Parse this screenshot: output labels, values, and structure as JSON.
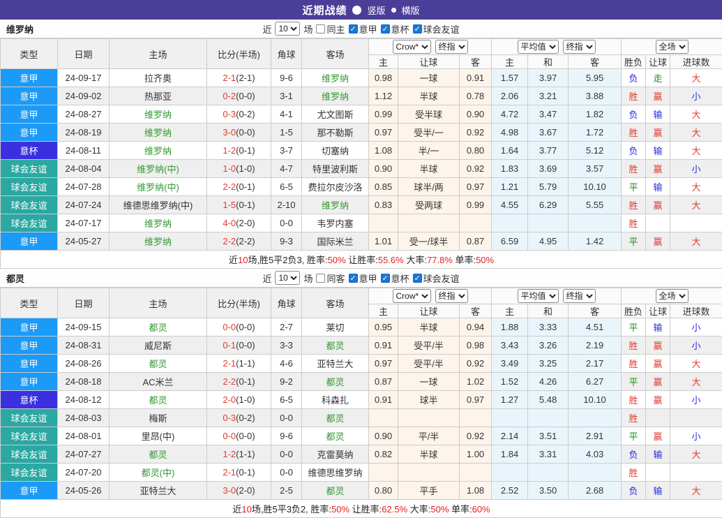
{
  "title_bar": {
    "title": "近期战绩",
    "radio_vertical": "竖版",
    "radio_horizontal": "横版"
  },
  "colors": {
    "titlebar_purple": "#4b3e98",
    "league_serie_a_blue": "#1b9af7",
    "league_cup_indigo": "#3a30e0",
    "league_friendly_teal": "#2aa8a1",
    "win_red": "#e23b2e",
    "lose_blue": "#2929e0",
    "draw_green": "#1e8c1e",
    "team_highlight_green": "#339933"
  },
  "table_header": {
    "cols": [
      "类型",
      "日期",
      "主场",
      "比分(半场)",
      "角球",
      "客场"
    ],
    "book_select": "Crow*",
    "final_select": "终指",
    "avg_select": "平均值",
    "final_select2": "终指",
    "fullmatch_select": "全场",
    "sub_cols": [
      "主",
      "让球",
      "客",
      "主",
      "和",
      "客",
      "胜负",
      "让球",
      "进球数"
    ]
  },
  "sections": [
    {
      "team": "维罗纳",
      "filter": {
        "near_label": "近",
        "games_value": "10",
        "games_label": "场",
        "same_label": "同主",
        "leagues": [
          "意甲",
          "意杯",
          "球会友谊"
        ]
      },
      "rows": [
        {
          "league": "意甲",
          "lk": "a",
          "date": "24-09-17",
          "home": "拉齐奥",
          "hh": false,
          "score": "2-1",
          "half": "(2-1)",
          "corner": "9-6",
          "away": "维罗纳",
          "ah": true,
          "o1": "0.98",
          "hc": "一球",
          "o2": "0.91",
          "m1": "1.57",
          "m2": "3.97",
          "m3": "5.95",
          "r1": "负",
          "r2": "走",
          "r3": "大"
        },
        {
          "league": "意甲",
          "lk": "a",
          "date": "24-09-02",
          "home": "热那亚",
          "hh": false,
          "score": "0-2",
          "half": "(0-0)",
          "corner": "3-1",
          "away": "维罗纳",
          "ah": true,
          "o1": "1.12",
          "hc": "半球",
          "o2": "0.78",
          "m1": "2.06",
          "m2": "3.21",
          "m3": "3.88",
          "r1": "胜",
          "r2": "赢",
          "r3": "小"
        },
        {
          "league": "意甲",
          "lk": "a",
          "date": "24-08-27",
          "home": "维罗纳",
          "hh": true,
          "score": "0-3",
          "half": "(0-2)",
          "corner": "4-1",
          "away": "尤文图斯",
          "ah": false,
          "o1": "0.99",
          "hc": "受半球",
          "o2": "0.90",
          "m1": "4.72",
          "m2": "3.47",
          "m3": "1.82",
          "r1": "负",
          "r2": "输",
          "r3": "大"
        },
        {
          "league": "意甲",
          "lk": "a",
          "date": "24-08-19",
          "home": "维罗纳",
          "hh": true,
          "score": "3-0",
          "half": "(0-0)",
          "corner": "1-5",
          "away": "那不勒斯",
          "ah": false,
          "o1": "0.97",
          "hc": "受半/一",
          "o2": "0.92",
          "m1": "4.98",
          "m2": "3.67",
          "m3": "1.72",
          "r1": "胜",
          "r2": "赢",
          "r3": "大"
        },
        {
          "league": "意杯",
          "lk": "c",
          "date": "24-08-11",
          "home": "维罗纳",
          "hh": true,
          "score": "1-2",
          "half": "(0-1)",
          "corner": "3-7",
          "away": "切塞纳",
          "ah": false,
          "o1": "1.08",
          "hc": "半/一",
          "o2": "0.80",
          "m1": "1.64",
          "m2": "3.77",
          "m3": "5.12",
          "r1": "负",
          "r2": "输",
          "r3": "大"
        },
        {
          "league": "球会友谊",
          "lk": "f",
          "date": "24-08-04",
          "home": "维罗纳(中)",
          "hh": true,
          "score": "1-0",
          "half": "(1-0)",
          "corner": "4-7",
          "away": "特里波利斯",
          "ah": false,
          "o1": "0.90",
          "hc": "半球",
          "o2": "0.92",
          "m1": "1.83",
          "m2": "3.69",
          "m3": "3.57",
          "r1": "胜",
          "r2": "赢",
          "r3": "小"
        },
        {
          "league": "球会友谊",
          "lk": "f",
          "date": "24-07-28",
          "home": "维罗纳(中)",
          "hh": true,
          "score": "2-2",
          "half": "(0-1)",
          "corner": "6-5",
          "away": "费拉尔皮沙洛",
          "ah": false,
          "o1": "0.85",
          "hc": "球半/两",
          "o2": "0.97",
          "m1": "1.21",
          "m2": "5.79",
          "m3": "10.10",
          "r1": "平",
          "r2": "输",
          "r3": "大"
        },
        {
          "league": "球会友谊",
          "lk": "f",
          "date": "24-07-24",
          "home": "维德思维罗纳(中)",
          "hh": false,
          "score": "1-5",
          "half": "(0-1)",
          "corner": "2-10",
          "away": "维罗纳",
          "ah": true,
          "o1": "0.83",
          "hc": "受两球",
          "o2": "0.99",
          "m1": "4.55",
          "m2": "6.29",
          "m3": "5.55",
          "r1": "胜",
          "r2": "赢",
          "r3": "大"
        },
        {
          "league": "球会友谊",
          "lk": "f",
          "date": "24-07-17",
          "home": "维罗纳",
          "hh": true,
          "score": "4-0",
          "half": "(2-0)",
          "corner": "0-0",
          "away": "韦罗内塞",
          "ah": false,
          "o1": "",
          "hc": "",
          "o2": "",
          "m1": "",
          "m2": "",
          "m3": "",
          "r1": "胜",
          "r2": "",
          "r3": ""
        },
        {
          "league": "意甲",
          "lk": "a",
          "date": "24-05-27",
          "home": "维罗纳",
          "hh": true,
          "score": "2-2",
          "half": "(2-2)",
          "corner": "9-3",
          "away": "国际米兰",
          "ah": false,
          "o1": "1.01",
          "hc": "受一/球半",
          "o2": "0.87",
          "m1": "6.59",
          "m2": "4.95",
          "m3": "1.42",
          "r1": "平",
          "r2": "赢",
          "r3": "大"
        }
      ],
      "summary": {
        "pre": "近",
        "n": "10",
        "t1": "场,胜5平2负3, 胜率:",
        "v1": "50%",
        "t2": " 让胜率:",
        "v2": "55.6%",
        "t3": " 大率:",
        "v3": "77.8%",
        "t4": " 单率:",
        "v4": "50%"
      }
    },
    {
      "team": "都灵",
      "filter": {
        "near_label": "近",
        "games_value": "10",
        "games_label": "场",
        "same_label": "同客",
        "leagues": [
          "意甲",
          "意杯",
          "球会友谊"
        ]
      },
      "rows": [
        {
          "league": "意甲",
          "lk": "a",
          "date": "24-09-15",
          "home": "都灵",
          "hh": true,
          "score": "0-0",
          "half": "(0-0)",
          "corner": "2-7",
          "away": "莱切",
          "ah": false,
          "o1": "0.95",
          "hc": "半球",
          "o2": "0.94",
          "m1": "1.88",
          "m2": "3.33",
          "m3": "4.51",
          "r1": "平",
          "r2": "输",
          "r3": "小"
        },
        {
          "league": "意甲",
          "lk": "a",
          "date": "24-08-31",
          "home": "威尼斯",
          "hh": false,
          "score": "0-1",
          "half": "(0-0)",
          "corner": "3-3",
          "away": "都灵",
          "ah": true,
          "o1": "0.91",
          "hc": "受平/半",
          "o2": "0.98",
          "m1": "3.43",
          "m2": "3.26",
          "m3": "2.19",
          "r1": "胜",
          "r2": "赢",
          "r3": "小"
        },
        {
          "league": "意甲",
          "lk": "a",
          "date": "24-08-26",
          "home": "都灵",
          "hh": true,
          "score": "2-1",
          "half": "(1-1)",
          "corner": "4-6",
          "away": "亚特兰大",
          "ah": false,
          "o1": "0.97",
          "hc": "受平/半",
          "o2": "0.92",
          "m1": "3.49",
          "m2": "3.25",
          "m3": "2.17",
          "r1": "胜",
          "r2": "赢",
          "r3": "大"
        },
        {
          "league": "意甲",
          "lk": "a",
          "date": "24-08-18",
          "home": "AC米兰",
          "hh": false,
          "score": "2-2",
          "half": "(0-1)",
          "corner": "9-2",
          "away": "都灵",
          "ah": true,
          "o1": "0.87",
          "hc": "一球",
          "o2": "1.02",
          "m1": "1.52",
          "m2": "4.26",
          "m3": "6.27",
          "r1": "平",
          "r2": "赢",
          "r3": "大"
        },
        {
          "league": "意杯",
          "lk": "c",
          "date": "24-08-12",
          "home": "都灵",
          "hh": true,
          "score": "2-0",
          "half": "(1-0)",
          "corner": "6-5",
          "away": "科森扎",
          "ah": false,
          "o1": "0.91",
          "hc": "球半",
          "o2": "0.97",
          "m1": "1.27",
          "m2": "5.48",
          "m3": "10.10",
          "r1": "胜",
          "r2": "赢",
          "r3": "小"
        },
        {
          "league": "球会友谊",
          "lk": "f",
          "date": "24-08-03",
          "home": "梅斯",
          "hh": false,
          "score": "0-3",
          "half": "(0-2)",
          "corner": "0-0",
          "away": "都灵",
          "ah": true,
          "o1": "",
          "hc": "",
          "o2": "",
          "m1": "",
          "m2": "",
          "m3": "",
          "r1": "胜",
          "r2": "",
          "r3": ""
        },
        {
          "league": "球会友谊",
          "lk": "f",
          "date": "24-08-01",
          "home": "里昂(中)",
          "hh": false,
          "score": "0-0",
          "half": "(0-0)",
          "corner": "9-6",
          "away": "都灵",
          "ah": true,
          "o1": "0.90",
          "hc": "平/半",
          "o2": "0.92",
          "m1": "2.14",
          "m2": "3.51",
          "m3": "2.91",
          "r1": "平",
          "r2": "赢",
          "r3": "小"
        },
        {
          "league": "球会友谊",
          "lk": "f",
          "date": "24-07-27",
          "home": "都灵",
          "hh": true,
          "score": "1-2",
          "half": "(1-1)",
          "corner": "0-0",
          "away": "克雷莫纳",
          "ah": false,
          "o1": "0.82",
          "hc": "半球",
          "o2": "1.00",
          "m1": "1.84",
          "m2": "3.31",
          "m3": "4.03",
          "r1": "负",
          "r2": "输",
          "r3": "大"
        },
        {
          "league": "球会友谊",
          "lk": "f",
          "date": "24-07-20",
          "home": "都灵(中)",
          "hh": true,
          "score": "2-1",
          "half": "(0-1)",
          "corner": "0-0",
          "away": "维德思维罗纳",
          "ah": false,
          "o1": "",
          "hc": "",
          "o2": "",
          "m1": "",
          "m2": "",
          "m3": "",
          "r1": "胜",
          "r2": "",
          "r3": ""
        },
        {
          "league": "意甲",
          "lk": "a",
          "date": "24-05-26",
          "home": "亚特兰大",
          "hh": false,
          "score": "3-0",
          "half": "(2-0)",
          "corner": "2-5",
          "away": "都灵",
          "ah": true,
          "o1": "0.80",
          "hc": "平手",
          "o2": "1.08",
          "m1": "2.52",
          "m2": "3.50",
          "m3": "2.68",
          "r1": "负",
          "r2": "输",
          "r3": "大"
        }
      ],
      "summary": {
        "pre": "近",
        "n": "10",
        "t1": "场,胜5平3负2, 胜率:",
        "v1": "50%",
        "t2": " 让胜率:",
        "v2": "62.5%",
        "t3": " 大率:",
        "v3": "50%",
        "t4": " 单率:",
        "v4": "60%"
      }
    }
  ]
}
